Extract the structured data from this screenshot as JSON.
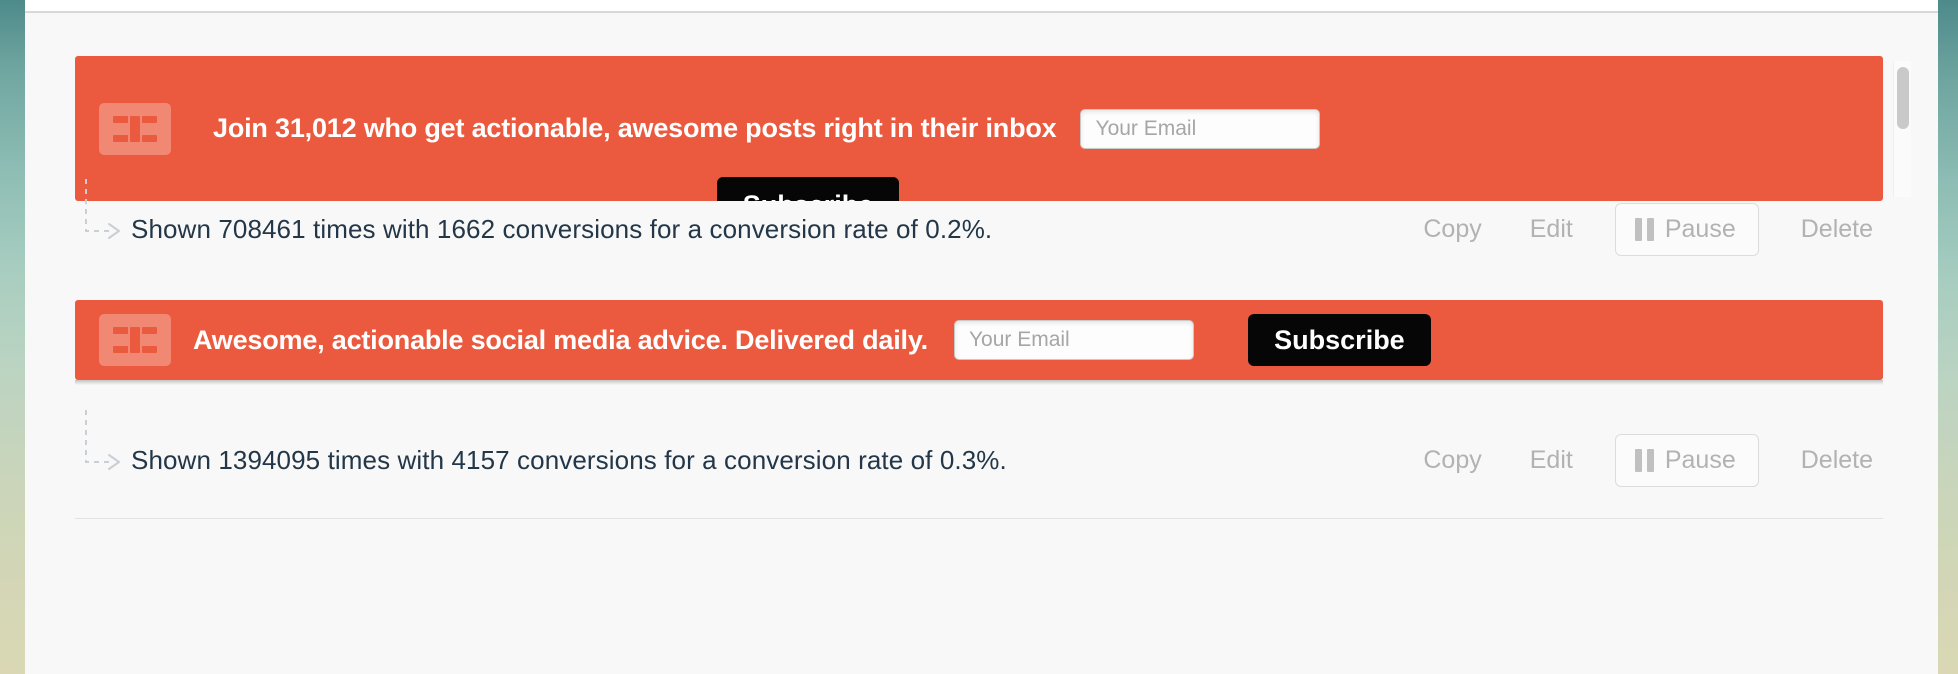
{
  "page": {
    "background_accent": "#eb5a3e",
    "text_color": "#233748",
    "muted_color": "#b2b2b2"
  },
  "bars": [
    {
      "id": "bar-1",
      "logo_icon": "hellobar-logo-icon",
      "headline": "Join 31,012 who get actionable, awesome posts right in their inbox",
      "email_placeholder": "Your Email",
      "email_value": "",
      "subscribe_label": "Subscribe",
      "accent_color": "#eb5a3e",
      "stats": {
        "text": "Shown 708461 times with 1662 conversions for a conversion rate of 0.2%.",
        "shown_count": "708461",
        "conversions": "1662",
        "conversion_rate": "0.2%"
      },
      "actions": {
        "copy_label": "Copy",
        "edit_label": "Edit",
        "pause_label": "Pause",
        "pause_icon": "pause-icon",
        "delete_label": "Delete"
      }
    },
    {
      "id": "bar-2",
      "logo_icon": "hellobar-logo-icon",
      "headline": "Awesome, actionable social media advice. Delivered daily.",
      "email_placeholder": "Your Email",
      "email_value": "",
      "subscribe_label": "Subscribe",
      "accent_color": "#eb5a3e",
      "stats": {
        "text": "Shown 1394095 times with 4157 conversions for a conversion rate of 0.3%.",
        "shown_count": "1394095",
        "conversions": "4157",
        "conversion_rate": "0.3%"
      },
      "actions": {
        "copy_label": "Copy",
        "edit_label": "Edit",
        "pause_label": "Pause",
        "pause_icon": "pause-icon",
        "delete_label": "Delete"
      }
    }
  ]
}
